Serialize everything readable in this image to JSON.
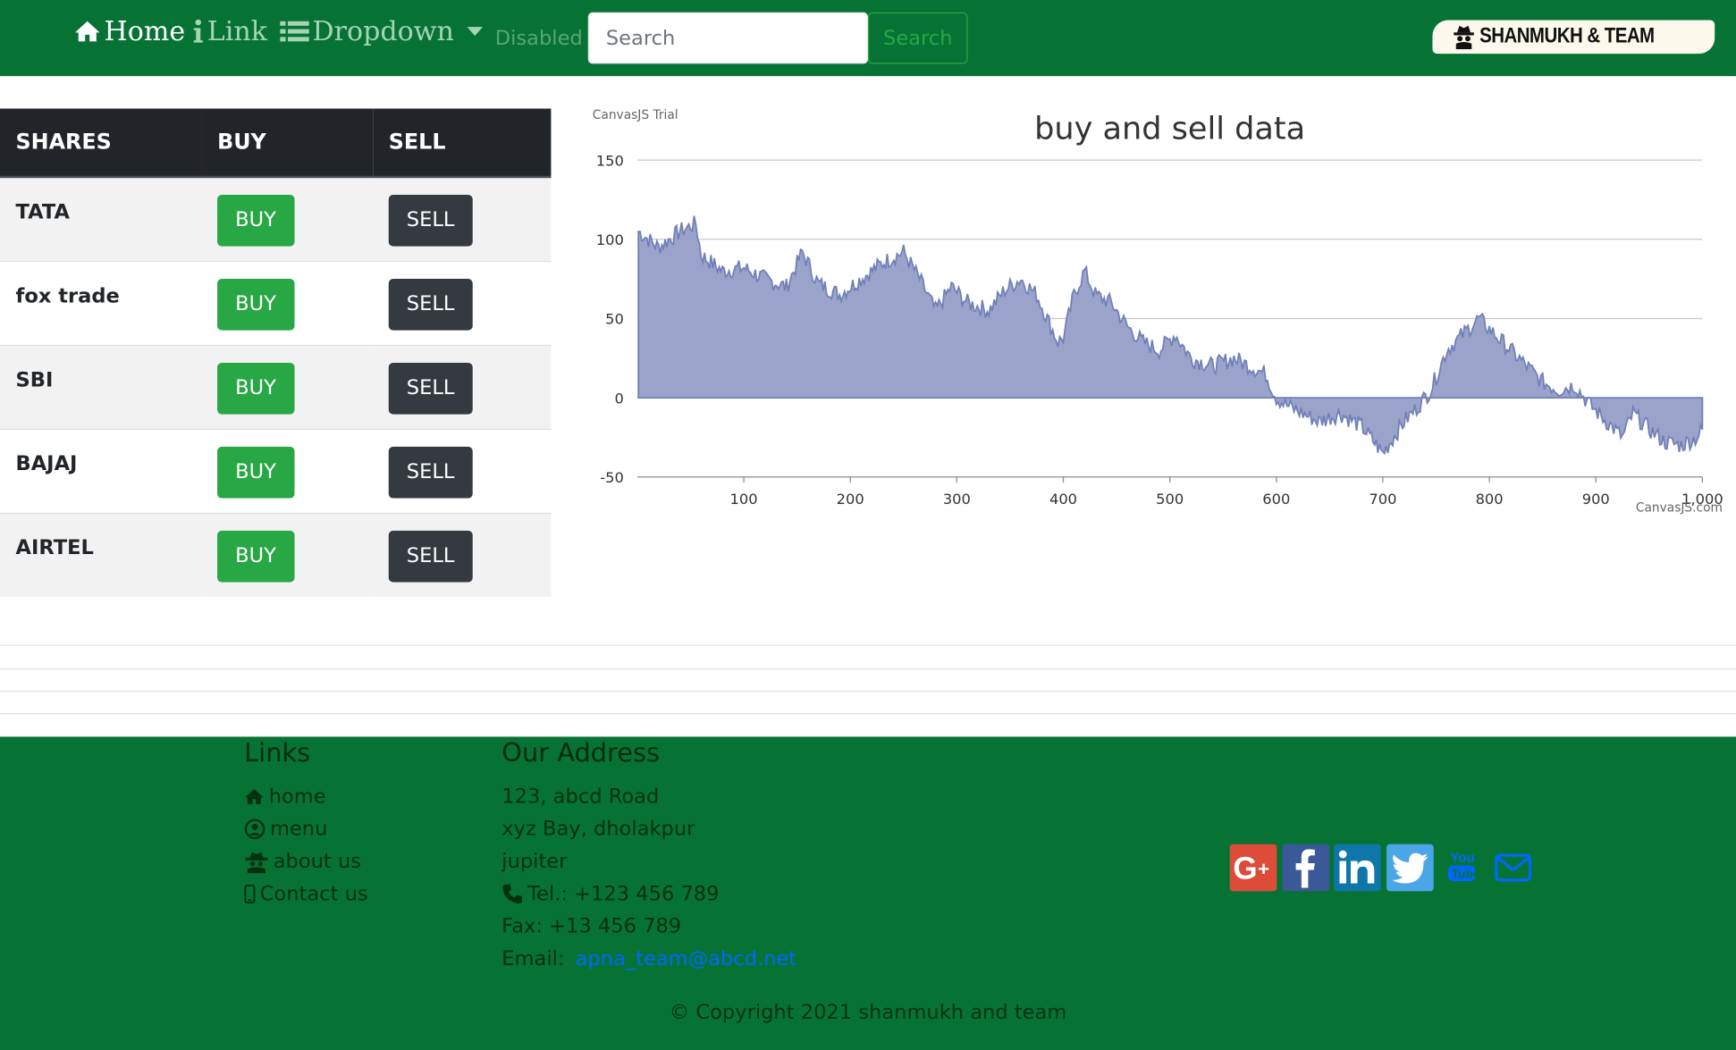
{
  "navbar": {
    "home": "Home",
    "link": "Link",
    "dropdown": "Dropdown",
    "disabled": "Disabled",
    "search_placeholder": "Search",
    "search_button": "Search",
    "brand": "SHANMUKH & TEAM",
    "color": "#067335"
  },
  "table": {
    "headers": [
      "SHARES",
      "BUY",
      "SELL"
    ],
    "rows": [
      {
        "name": "TATA",
        "buy": "BUY",
        "sell": "SELL"
      },
      {
        "name": "fox trade",
        "buy": "BUY",
        "sell": "SELL"
      },
      {
        "name": "SBI",
        "buy": "BUY",
        "sell": "SELL"
      },
      {
        "name": "BAJAJ",
        "buy": "BUY",
        "sell": "SELL"
      },
      {
        "name": "AIRTEL",
        "buy": "BUY",
        "sell": "SELL"
      }
    ]
  },
  "chart_data": {
    "type": "area",
    "title": "buy and sell data",
    "watermark": "CanvasJS Trial",
    "credit": "CanvasJS.com",
    "xlabel": "",
    "ylabel": "",
    "xlim": [
      0,
      1000
    ],
    "ylim": [
      -50,
      150
    ],
    "x_ticks": [
      "100",
      "200",
      "300",
      "400",
      "500",
      "600",
      "700",
      "800",
      "900",
      "1,000"
    ],
    "y_ticks": [
      "150",
      "100",
      "50",
      "0",
      "-50"
    ],
    "grid": "horizontal",
    "color": "#6f7fb8",
    "fill_color": "#9aa3c9",
    "x": [
      1,
      20,
      40,
      55,
      60,
      80,
      100,
      120,
      140,
      155,
      170,
      190,
      210,
      230,
      250,
      265,
      280,
      295,
      310,
      330,
      345,
      360,
      375,
      385,
      395,
      400,
      410,
      420,
      430,
      445,
      460,
      475,
      490,
      505,
      520,
      540,
      560,
      575,
      590,
      600,
      610,
      625,
      640,
      660,
      680,
      700,
      720,
      730,
      745,
      760,
      775,
      790,
      805,
      820,
      835,
      850,
      865,
      880,
      895,
      910,
      925,
      935,
      950,
      965,
      980,
      995,
      1000
    ],
    "y": [
      105,
      95,
      105,
      110,
      90,
      80,
      82,
      75,
      70,
      92,
      72,
      65,
      75,
      85,
      92,
      75,
      55,
      70,
      60,
      55,
      68,
      75,
      65,
      50,
      35,
      38,
      65,
      80,
      65,
      60,
      45,
      35,
      30,
      40,
      25,
      20,
      25,
      20,
      15,
      0,
      -5,
      -10,
      -15,
      -10,
      -18,
      -35,
      -15,
      -8,
      5,
      30,
      40,
      50,
      40,
      30,
      20,
      10,
      5,
      8,
      -5,
      -15,
      -25,
      -10,
      -20,
      -28,
      -30,
      -25,
      -20
    ]
  },
  "footer": {
    "links_heading": "Links",
    "links": [
      "home",
      "menu",
      "about us",
      "Contact us"
    ],
    "address_heading": "Our Address",
    "address_lines": [
      "123, abcd Road",
      "xyz Bay, dholakpur",
      "jupiter"
    ],
    "tel": "Tel.: +123 456 789",
    "fax": "Fax: +13 456 789",
    "email_label": "Email: ",
    "email": "apna_team@abcd.net",
    "social_icons": [
      "google-plus-icon",
      "facebook-icon",
      "linkedin-icon",
      "twitter-icon",
      "youtube-icon",
      "mail-icon"
    ],
    "copyright": "© Copyright 2021 shanmukh and team"
  }
}
